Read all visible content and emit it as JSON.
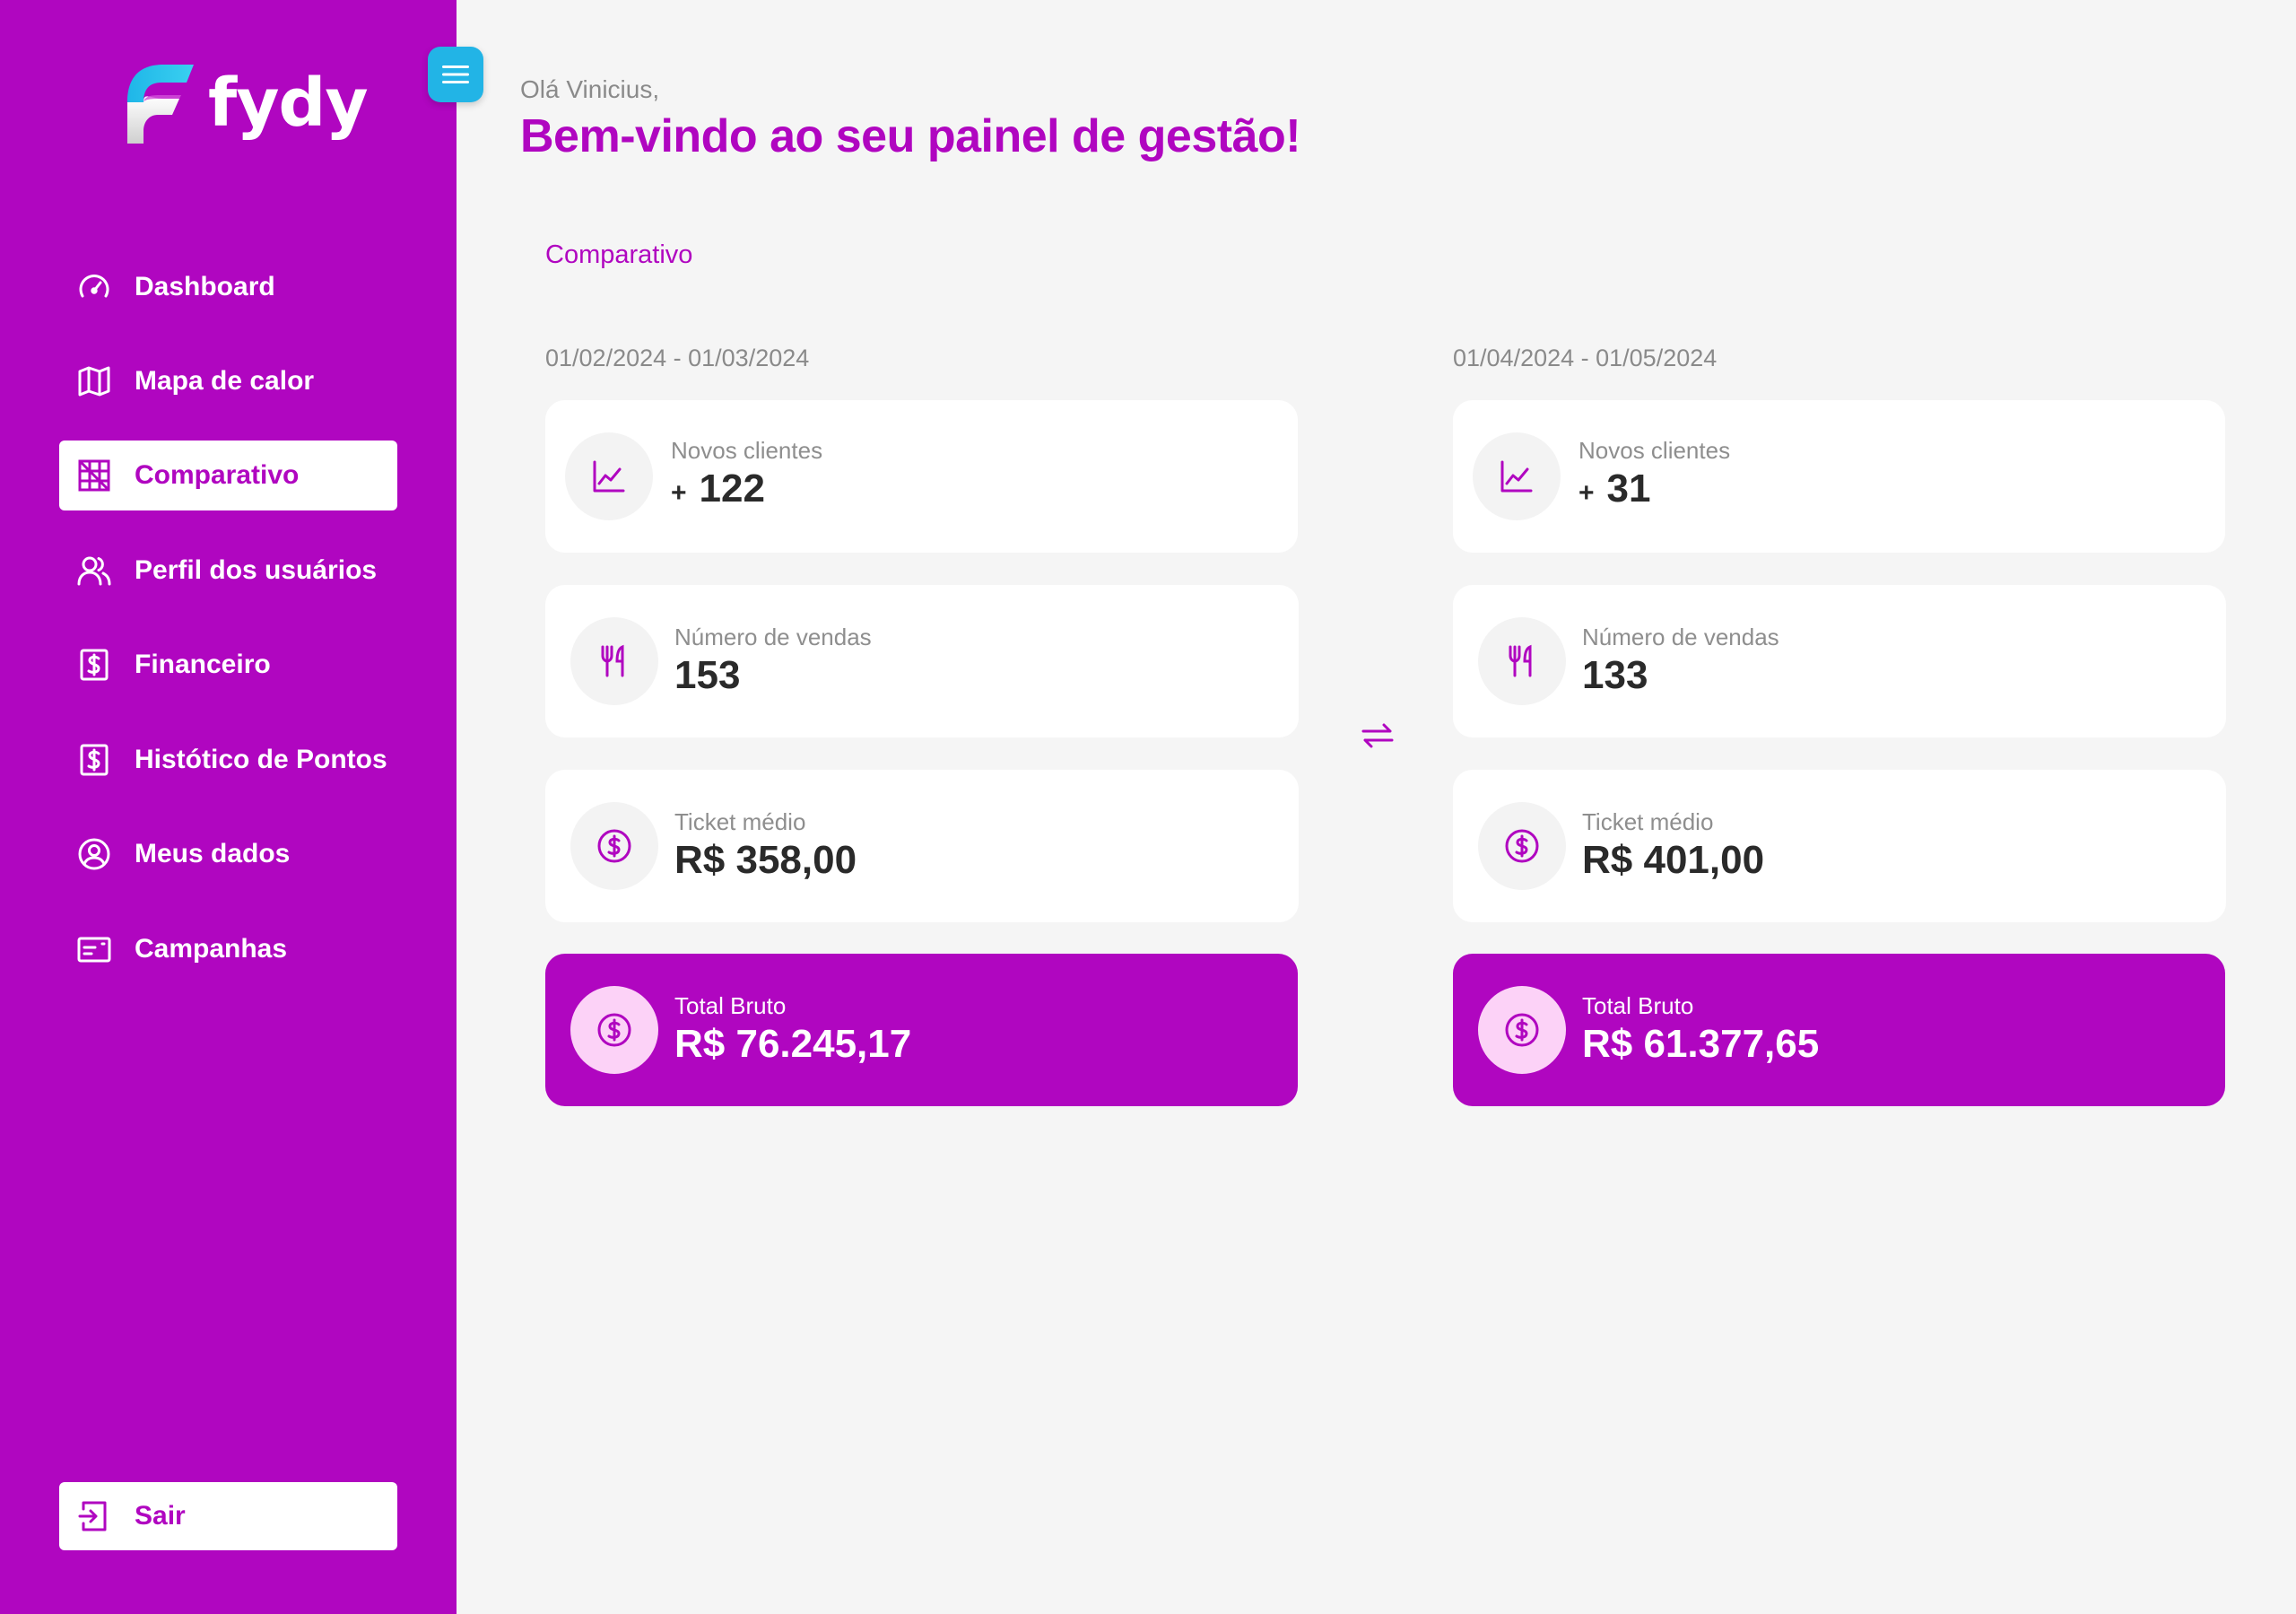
{
  "app": {
    "brand": "fydy"
  },
  "sidebar": {
    "items": [
      {
        "label": "Dashboard",
        "icon": "gauge-icon",
        "active": false
      },
      {
        "label": "Mapa de calor",
        "icon": "map-icon",
        "active": false
      },
      {
        "label": "Comparativo",
        "icon": "compare-grid-icon",
        "active": true
      },
      {
        "label": "Perfil dos usuários",
        "icon": "users-icon",
        "active": false
      },
      {
        "label": "Financeiro",
        "icon": "dollar-square-icon",
        "active": false
      },
      {
        "label": "Histótico de Pontos",
        "icon": "dollar-square-icon",
        "active": false
      },
      {
        "label": "Meus dados",
        "icon": "user-circle-icon",
        "active": false
      },
      {
        "label": "Campanhas",
        "icon": "id-card-icon",
        "active": false
      }
    ],
    "logout_label": "Sair"
  },
  "header": {
    "greeting": "Olá Vinicius,",
    "title": "Bem-vindo ao seu painel de gestão!"
  },
  "comparison": {
    "section_title": "Comparativo",
    "periods": [
      {
        "range": "01/02/2024 - 01/03/2024",
        "new_clients": {
          "label": "Novos clientes",
          "prefix": "+",
          "value": "122"
        },
        "sales": {
          "label": "Número de vendas",
          "value": "153"
        },
        "ticket": {
          "label": "Ticket médio",
          "value": "R$ 358,00"
        },
        "total": {
          "label": "Total Bruto",
          "value": "R$ 76.245,17"
        }
      },
      {
        "range": "01/04/2024 - 01/05/2024",
        "new_clients": {
          "label": "Novos clientes",
          "prefix": "+",
          "value": "31"
        },
        "sales": {
          "label": "Número de vendas",
          "value": "133"
        },
        "ticket": {
          "label": "Ticket médio",
          "value": "R$ 401,00"
        },
        "total": {
          "label": "Total Bruto",
          "value": "R$ 61.377,65"
        }
      }
    ]
  },
  "colors": {
    "brand": "#b006c0",
    "toggle": "#22b4e6",
    "background": "#f5f5f5"
  }
}
